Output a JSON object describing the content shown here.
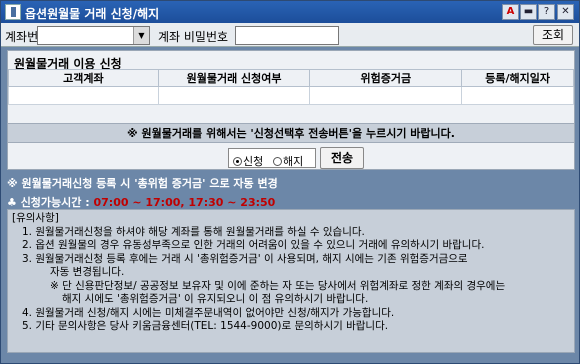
{
  "window": {
    "title": "옵션원월물 거래 신청/해지"
  },
  "title_buttons": [
    "A",
    "▬",
    "?",
    "✕"
  ],
  "toolbar": {
    "account_label": "계좌번호",
    "password_label": "계좌 비밀번호",
    "account_value": "",
    "password_value": "",
    "search_button": "조회"
  },
  "panel": {
    "title": "원월물거래 이용 신청",
    "columns": [
      "고객계좌",
      "원월물거래 신청여부",
      "위험증거금",
      "등록/해지일자"
    ],
    "row": [
      "",
      "",
      "",
      ""
    ],
    "notice": "※ 원월물거래를 위해서는 '신청선택후 전송버튼'을 누르시기 바랍니다.",
    "radio_apply": "신청",
    "radio_cancel": "해지",
    "send_button": "전송"
  },
  "info": {
    "auto_change": "※ 원월물거래신청 등록 시  '총위험 증거금' 으로 자동 변경",
    "time_label": "♣ 신청가능시간 :",
    "time_value": "07:00 ~ 17:00, 17:30 ~ 23:50"
  },
  "notes": {
    "header": "[유의사항]",
    "lines": [
      "1.  원월물거래신청을 하셔야 해당 계좌를 통해 원월물거래를 하실 수 있습니다.",
      "2.  옵션 원월물의 경우 유동성부족으로 인한 거래의 어려움이 있을 수 있으니 거래에 유의하시기 바랍니다.",
      "3.  원월물거래신청 등록 후에는 거래 시 '총위험증거금' 이 사용되며, 해지 시에는 기존 위험증거금으로",
      "자동 변경됩니다.",
      "※ 단 신용판단정보/ 공공정보 보유자 및 이에 준하는 자 또는 당사에서 위험계좌로 정한 계좌의 경우에는",
      "해지 시에도  '총위험증거금'  이 유지되오니 이 점 유의하시기 바랍니다.",
      "4.  원월물거래 신청/해지 시에는 미체결주문내역이 없어야만 신청/해지가 가능합니다.",
      "5.  기타 문의사항은 당사 키움금융센터(TEL: 1544-9000)로 문의하시기 바랍니다."
    ]
  },
  "colors": {
    "titlebar": "#1c4e9a",
    "window_bg": "#6c87a8",
    "accent_time": "#c00000"
  }
}
